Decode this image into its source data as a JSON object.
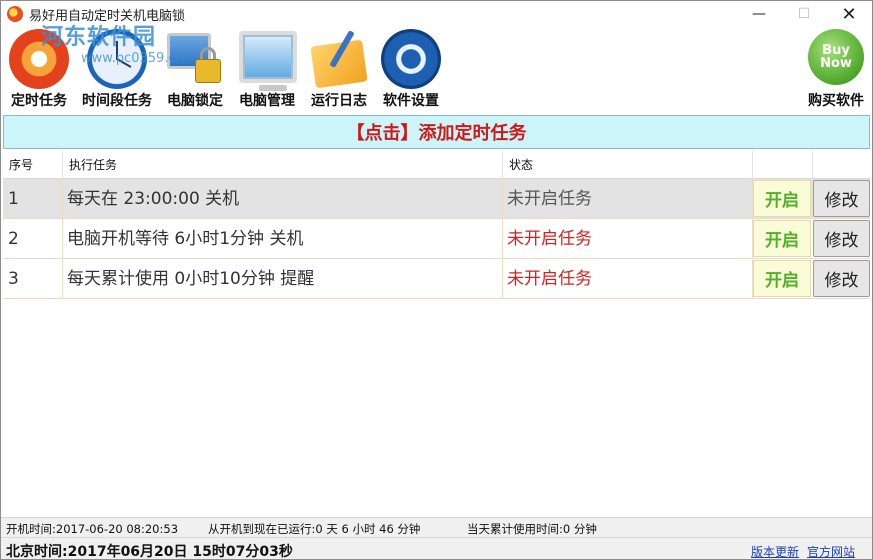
{
  "window": {
    "title": "易好用自动定时关机电脑锁",
    "minimize": "—",
    "maximize": "☐",
    "close": "✕"
  },
  "watermark": {
    "name": "河东软件园",
    "url": "www.pc0359.cn"
  },
  "toolbar": {
    "items": [
      {
        "label": "定时任务",
        "icon": "timer-icon"
      },
      {
        "label": "时间段任务",
        "icon": "clock-icon"
      },
      {
        "label": "电脑锁定",
        "icon": "lock-monitor-icon"
      },
      {
        "label": "电脑管理",
        "icon": "monitor-icon"
      },
      {
        "label": "运行日志",
        "icon": "notebook-pen-icon"
      },
      {
        "label": "软件设置",
        "icon": "gear-icon"
      }
    ],
    "buy": {
      "label": "购买软件",
      "badge_line1": "Buy",
      "badge_line2": "Now"
    }
  },
  "add_task_label": "【点击】添加定时任务",
  "table": {
    "headers": [
      "序号",
      "执行任务",
      "状态",
      "",
      ""
    ],
    "rows": [
      {
        "num": "1",
        "task": "每天在 23:00:00 关机",
        "status": "未开启任务",
        "on_label": "开启",
        "edit_label": "修改",
        "selected": true
      },
      {
        "num": "2",
        "task": "电脑开机等待 6小时1分钟 关机",
        "status": "未开启任务",
        "on_label": "开启",
        "edit_label": "修改",
        "selected": false
      },
      {
        "num": "3",
        "task": "每天累计使用 0小时10分钟 提醒",
        "status": "未开启任务",
        "on_label": "开启",
        "edit_label": "修改",
        "selected": false
      }
    ]
  },
  "status_bar": {
    "boot_time": "开机时间:2017-06-20 08:20:53",
    "uptime": "从开机到现在已运行:0 天 6 小时 46 分钟",
    "usage_today": "当天累计使用时间:0 分钟",
    "beijing_time": "北京时间:2017年06月20日 15时07分03秒",
    "update_link": "版本更新",
    "website_link": "官方网站"
  },
  "colors": {
    "banner_bg": "#ccf5fa",
    "banner_text": "#cc1a1a",
    "status_red": "#d42020",
    "on_text": "#50b02a",
    "link": "#1a3fbf"
  }
}
